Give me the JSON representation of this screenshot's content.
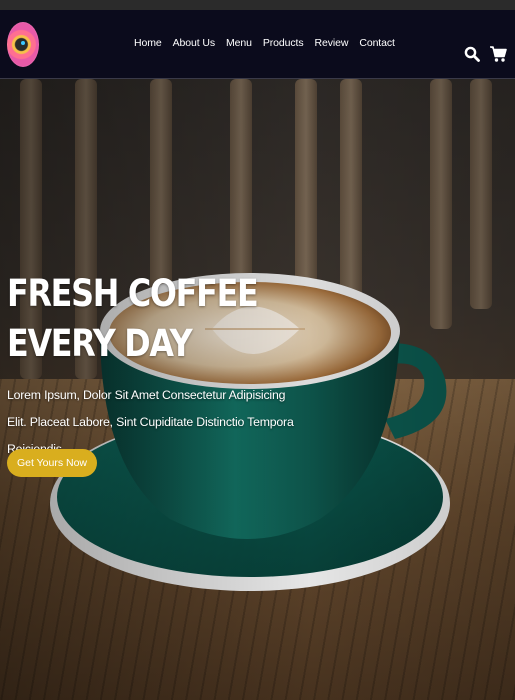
{
  "nav": {
    "links": [
      "Home",
      "About Us",
      "Menu",
      "Products",
      "Review",
      "Contact"
    ],
    "icons": [
      "search-icon",
      "cart-icon"
    ]
  },
  "hero": {
    "title_line1": "FRESH COFFEE",
    "title_line2": "EVERY DAY",
    "text": "Lorem Ipsum, Dolor Sit Amet Consectetur Adipisicing Elit. Placeat Labore, Sint Cupiditate Distinctio Tempora Reiciendis.",
    "cta_label": "Get Yours Now"
  },
  "colors": {
    "navbar_bg": "#0b0b1c",
    "cta_bg": "#d9ae1e",
    "cup": "#0f5f55"
  }
}
